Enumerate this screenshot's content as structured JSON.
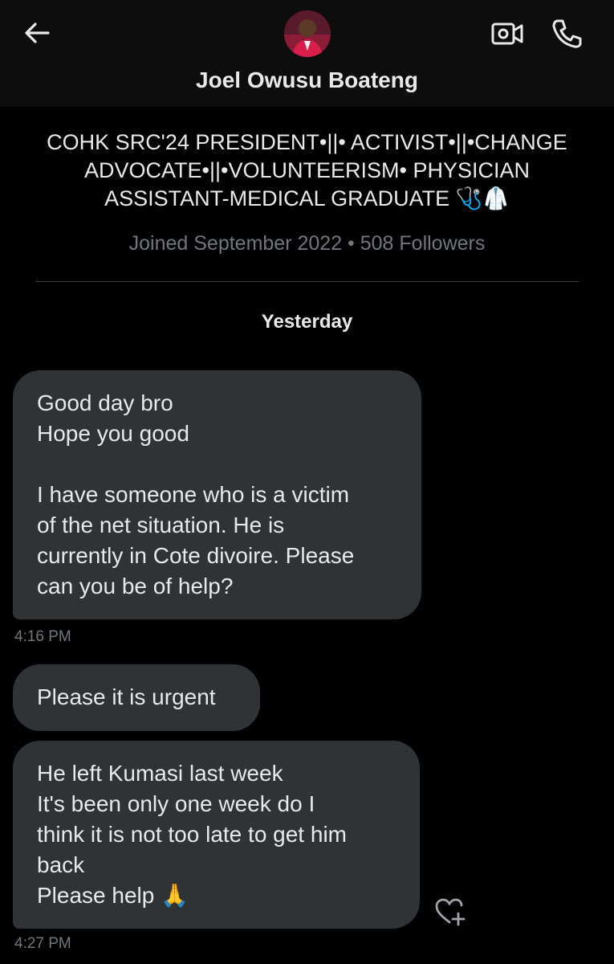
{
  "header": {
    "name": "Joel Owusu Boateng",
    "back_icon": "arrow-left-icon",
    "video_icon": "video-call-icon",
    "call_icon": "phone-icon"
  },
  "profile": {
    "bio": "COHK SRC'24 PRESIDENT•||• ACTIVIST•||•CHANGE\nADVOCATE•||•VOLUNTEERISM• PHYSICIAN\nASSISTANT-MEDICAL  GRADUATE 🩺🥼",
    "meta": "Joined September 2022 • 508 Followers"
  },
  "conversation": {
    "date_separator": "Yesterday",
    "messages": [
      {
        "text": "Good day bro\nHope you good\n\nI have someone who is a victim\nof the net situation. He is\ncurrently in Cote divoire. Please\ncan you be of help?"
      },
      {
        "text": "Please it is urgent"
      },
      {
        "text": "He left Kumasi last week\nIt's been only one week do I\nthink it is not too late to get him\nback\nPlease help 🙏"
      }
    ],
    "timestamps": [
      "4:16 PM",
      "4:27 PM"
    ],
    "react_icon": "heart-add-icon"
  },
  "colors": {
    "background": "#000000",
    "bubble": "#2f3336",
    "text": "#e7e9ea",
    "muted": "#71767b"
  }
}
